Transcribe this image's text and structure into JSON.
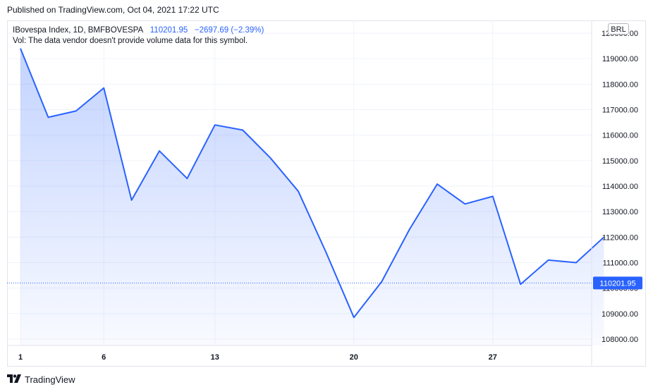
{
  "header": {
    "published": "Published on TradingView.com, Oct 04, 2021 17:22 UTC"
  },
  "legend": {
    "symbol": "IBovespa Index, 1D, BMFBOVESPA",
    "price": "110201.95",
    "change": "−2697.69 (−2.39%)",
    "volume_note": "Vol: The data vendor doesn't provide volume data for this symbol."
  },
  "currency": "BRL",
  "footer": {
    "brand": "TradingView"
  },
  "colors": {
    "line": "#2962ff",
    "grid": "#f0f3fa",
    "text": "#131722",
    "last_price_bg": "#2962ff"
  },
  "chart_data": {
    "type": "area",
    "x": [
      1,
      2,
      3,
      4,
      5,
      6,
      7,
      8,
      9,
      10,
      11,
      12,
      13,
      14,
      15,
      16,
      17,
      18,
      19,
      20,
      21,
      22
    ],
    "x_ticks": [
      {
        "label": "1",
        "index": 1
      },
      {
        "label": "6",
        "index": 4
      },
      {
        "label": "13",
        "index": 8
      },
      {
        "label": "20",
        "index": 13
      },
      {
        "label": "27",
        "index": 18
      }
    ],
    "values": [
      119400,
      116700,
      116950,
      117850,
      113450,
      115380,
      114300,
      116400,
      116200,
      115100,
      113800,
      111400,
      108850,
      110250,
      112300,
      114080,
      113300,
      113600,
      110150,
      111100,
      111000,
      112000
    ],
    "ylim": [
      107750,
      120500
    ],
    "y_ticks": [
      108000,
      109000,
      110000,
      111000,
      112000,
      113000,
      114000,
      115000,
      116000,
      117000,
      118000,
      119000,
      120000
    ],
    "y_tick_labels": [
      "108000.00",
      "109000.00",
      "110000.00",
      "111000.00",
      "112000.00",
      "113000.00",
      "114000.00",
      "115000.00",
      "116000.00",
      "117000.00",
      "118000.00",
      "119000.00",
      "120000.00"
    ],
    "last_price": 110201.95,
    "last_price_label": "110201.95",
    "grid": true
  }
}
